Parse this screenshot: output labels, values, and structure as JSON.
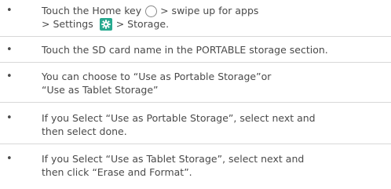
{
  "bullet": "•",
  "items": [
    {
      "line1_before_icon": "Touch the Home key",
      "line1_after_icon": "> swipe up for apps",
      "line2_before_icon": "> Settings",
      "line2_after_icon": "> Storage."
    },
    {
      "line1": "Touch the SD card name in the PORTABLE storage section."
    },
    {
      "line1": "You can choose to “Use as Portable Storage”or",
      "line2": "“Use as Tablet Storage”"
    },
    {
      "line1": "If you Select “Use as Portable Storage”, select next and",
      "line2": "then select done."
    },
    {
      "line1": "If you Select “Use as Tablet Storage”, select next and",
      "line2": "then click “Erase and Format”."
    }
  ],
  "icons": {
    "home": "home-key-icon",
    "settings": "settings-gear-icon",
    "settings_color": "#27a98f"
  }
}
